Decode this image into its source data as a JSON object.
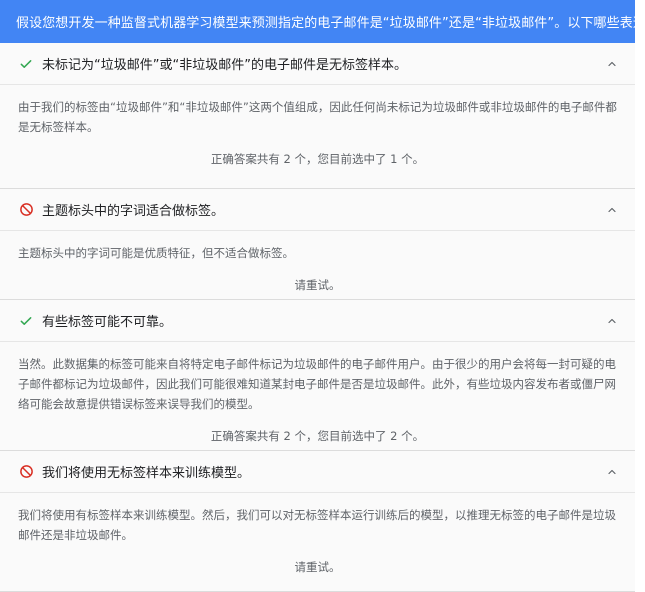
{
  "question": "假设您想开发一种监督式机器学习模型来预测指定的电子邮件是“垃圾邮件”还是“非垃圾邮件”。以下哪些表述正确?",
  "colors": {
    "header_bg": "#4285f4",
    "correct": "#34a853",
    "wrong": "#d93025"
  },
  "options": [
    {
      "icon": "check-icon",
      "title": "未标记为“垃圾邮件”或“非垃圾邮件”的电子邮件是无标签样本。",
      "explanation": "由于我们的标签由“垃圾邮件”和“非垃圾邮件”这两个值组成，因此任何尚未标记为垃圾邮件或非垃圾邮件的电子邮件都是无标签样本。",
      "status": "正确答案共有 2 个，您目前选中了 1 个。"
    },
    {
      "icon": "prohibited-icon",
      "title": "主题标头中的字词适合做标签。",
      "explanation": "主题标头中的字词可能是优质特征，但不适合做标签。",
      "status": "请重试。"
    },
    {
      "icon": "check-icon",
      "title": "有些标签可能不可靠。",
      "explanation": "当然。此数据集的标签可能来自将特定电子邮件标记为垃圾邮件的电子邮件用户。由于很少的用户会将每一封可疑的电子邮件都标记为垃圾邮件，因此我们可能很难知道某封电子邮件是否是垃圾邮件。此外，有些垃圾内容发布者或僵尸网络可能会故意提供错误标签来误导我们的模型。",
      "status": "正确答案共有 2 个，您目前选中了 2 个。"
    },
    {
      "icon": "prohibited-icon",
      "title": "我们将使用无标签样本来训练模型。",
      "explanation": "我们将使用有标签样本来训练模型。然后，我们可以对无标签样本运行训练后的模型，以推理无标签的电子邮件是垃圾邮件还是非垃圾邮件。",
      "status": "请重试。"
    }
  ]
}
